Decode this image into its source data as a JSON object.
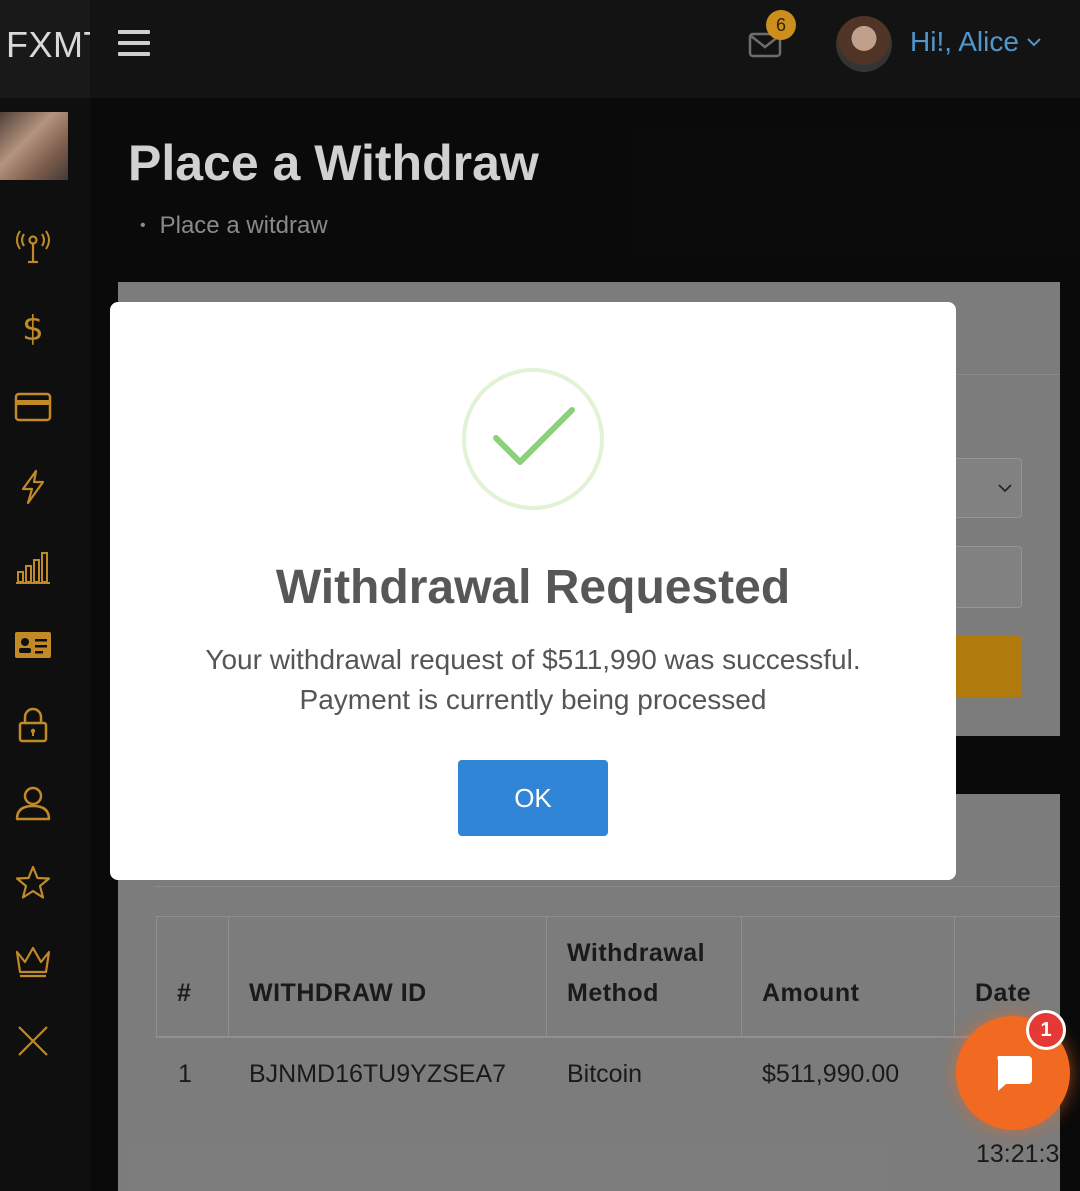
{
  "header": {
    "brand": "FXMT",
    "mail_badge_count": "6",
    "greeting": "Hi!, Alice"
  },
  "page": {
    "title": "Place a Withdraw",
    "breadcrumb": "Place a witdraw"
  },
  "modal": {
    "title": "Withdrawal Requested",
    "message": "Your withdrawal request of $511,990 was successful. Payment is currently being processed",
    "ok_label": "OK"
  },
  "table": {
    "headers": [
      "#",
      "WITHDRAW ID",
      "Withdrawal Method",
      "Amount",
      "Date"
    ],
    "rows": [
      {
        "index": "1",
        "withdraw_id": "BJNMD16TU9YZSEA7",
        "method": "Bitcoin",
        "amount": "$511,990.00",
        "time_partial": "13:21:3"
      }
    ]
  },
  "chat": {
    "badge_count": "1"
  },
  "colors": {
    "accent_gold": "#e5a020",
    "link_blue": "#5aa7e3",
    "button_blue": "#3085d6",
    "success_green": "#8bd17c",
    "chat_orange": "#f26a21"
  },
  "sidebar_icons": [
    "signal-icon",
    "dollar-icon",
    "credit-card-icon",
    "lightning-icon",
    "bar-chart-icon",
    "id-card-icon",
    "lock-icon",
    "user-icon",
    "star-icon",
    "crown-icon",
    "close-icon"
  ]
}
